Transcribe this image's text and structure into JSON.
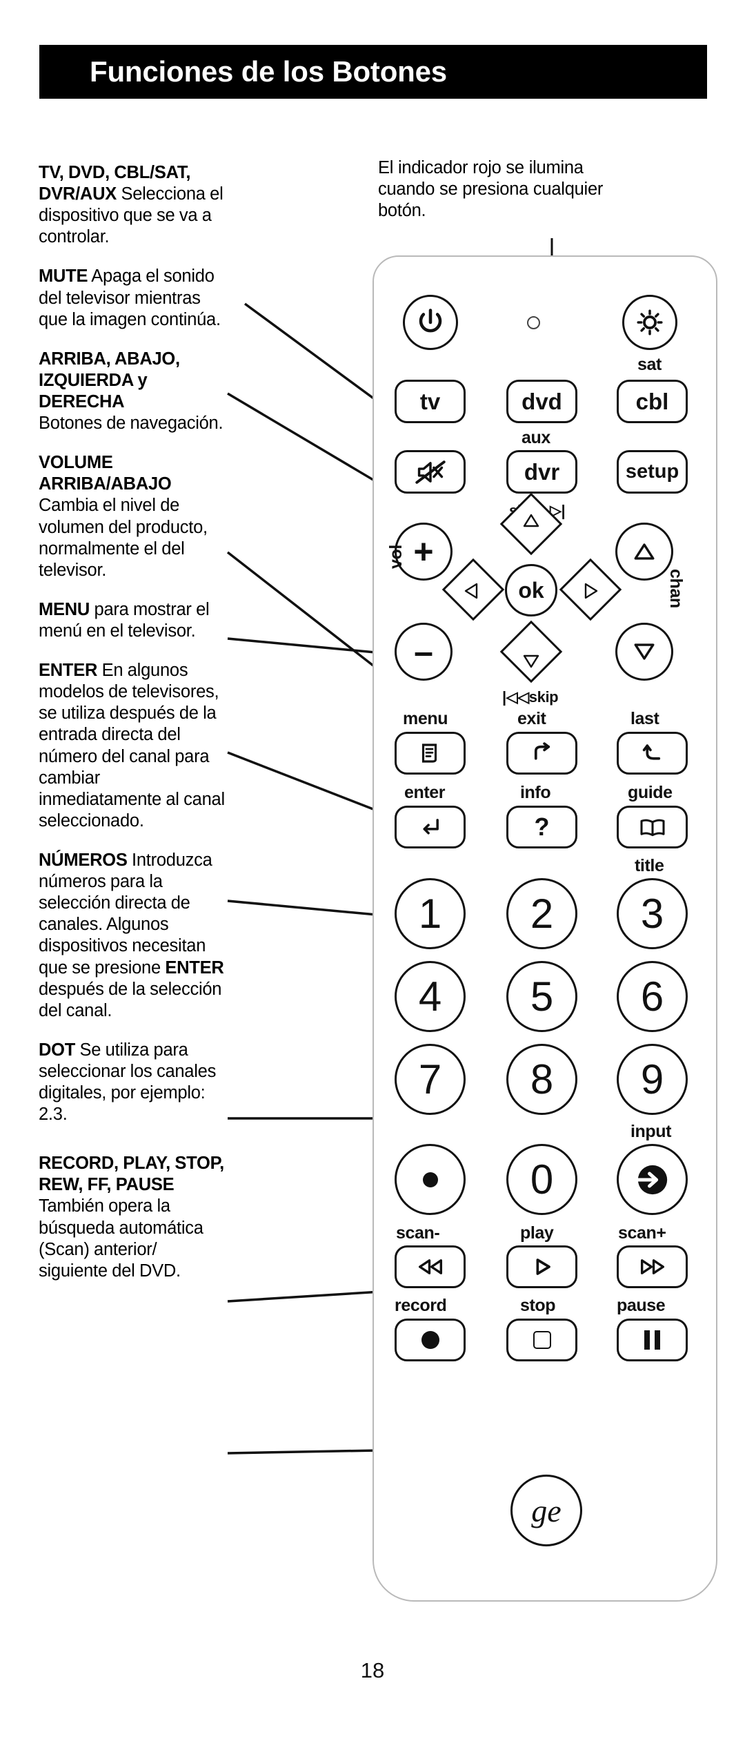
{
  "header": {
    "title": "Funciones de los Botones"
  },
  "callout": {
    "text": "El indicador rojo se ilumina cuando se presiona cualquier botón."
  },
  "page_number": "18",
  "entries": [
    {
      "id": "tv-dvd-cbl-sat-dvr-aux",
      "term": "TV, DVD, CBL/SAT, DVR/AUX",
      "desc": "Selecciona el dispositivo que se va a controlar."
    },
    {
      "id": "mute",
      "term": "MUTE",
      "desc": "Apaga el sonido del televisor mientras que la imagen continúa."
    },
    {
      "id": "arriba-abajo-izquierda-derecha",
      "term": "ARRIBA, ABAJO, IZQUIERDA y DERECHA",
      "desc": "Botones de navegación."
    },
    {
      "id": "volume-arriba-abajo",
      "term": "VOLUME ARRIBA/ABAJO",
      "desc": "Cambia el nivel de volumen del producto, normalmente el del televisor."
    },
    {
      "id": "menu",
      "term": "MENU",
      "desc": "para mostrar el menú en el televisor."
    },
    {
      "id": "enter",
      "term": "ENTER",
      "desc": "En algunos modelos de televisores, se utiliza después de la entrada directa del número del canal para cambiar inmediatamente al canal seleccionado."
    },
    {
      "id": "numeros",
      "term": "NÚMEROS",
      "desc": "Introduzca números para la selección directa de canales. Algunos dispositivos necesitan que se presione",
      "term2": "ENTER",
      "desc2": "después de la selección del canal."
    },
    {
      "id": "dot",
      "term": "DOT",
      "desc": "Se utiliza para seleccionar los canales digitales, por ejemplo: 2.3."
    },
    {
      "id": "record-play-stop-rew-ff-pause",
      "term": "RECORD, PLAY, STOP, REW, FF, PAUSE",
      "desc": "También opera la búsqueda automática (Scan) anterior/ siguiente del DVD."
    }
  ],
  "remote": {
    "power_button": "power-icon",
    "led_indicator": "red-led-indicator",
    "light_button": "light-bulb-icon",
    "light_label": "sat",
    "device_row_1": [
      "tv",
      "dvd",
      "cbl"
    ],
    "aux_label": "aux",
    "mute_button": "mute-icon",
    "device_row_2": [
      "dvr",
      "setup"
    ],
    "vol_plus": "+",
    "vol_minus": "–",
    "vol_label": "vol",
    "chan_label": "chan",
    "skip_forward_label": "skip",
    "skip_back_label": "skip",
    "ok_label": "ok",
    "nav_labels": [
      "menu",
      "exit",
      "last"
    ],
    "fn_row_1_labels": [
      "enter",
      "info",
      "guide"
    ],
    "fn_row_2_label": "title",
    "numbers": [
      "1",
      "2",
      "3",
      "4",
      "5",
      "6",
      "7",
      "8",
      "9"
    ],
    "dot_button": "dot-icon",
    "zero_button": "0",
    "input_button": "input-icon",
    "input_label": "input",
    "transport_labels_top": [
      "scan-",
      "play",
      "scan+"
    ],
    "transport_labels_bottom": [
      "record",
      "stop",
      "pause"
    ],
    "brand": "ge"
  }
}
